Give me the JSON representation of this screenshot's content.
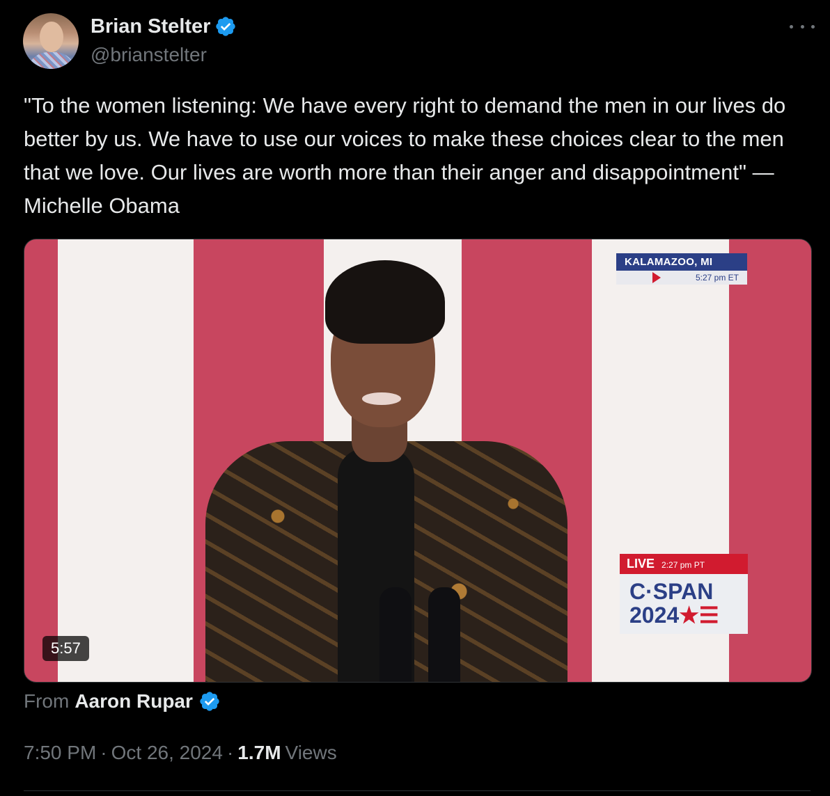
{
  "author": {
    "name": "Brian Stelter",
    "handle": "@brianstelter"
  },
  "tweet": {
    "text": "\"To the women listening: We have every right to demand the men in our lives do better by us. We have to use our voices to make these choices clear to the men that we love. Our lives are worth more than their anger and disappointment\" —Michelle Obama"
  },
  "media": {
    "location": "KALAMAZOO, MI",
    "location_time": "5:27 pm ET",
    "live_label": "LIVE",
    "live_time": "2:27 pm PT",
    "network": "C·SPAN",
    "network_year": "2024",
    "network_mark": "★☰",
    "duration": "5:57"
  },
  "attribution": {
    "prefix": "From",
    "name": "Aaron Rupar"
  },
  "meta": {
    "time": "7:50 PM",
    "separator": "·",
    "date": "Oct 26, 2024",
    "views_count": "1.7M",
    "views_label": "Views"
  },
  "colors": {
    "background": "#000000",
    "text": "#e7e9ea",
    "muted": "#71767b",
    "verified": "#1d9bf0"
  }
}
